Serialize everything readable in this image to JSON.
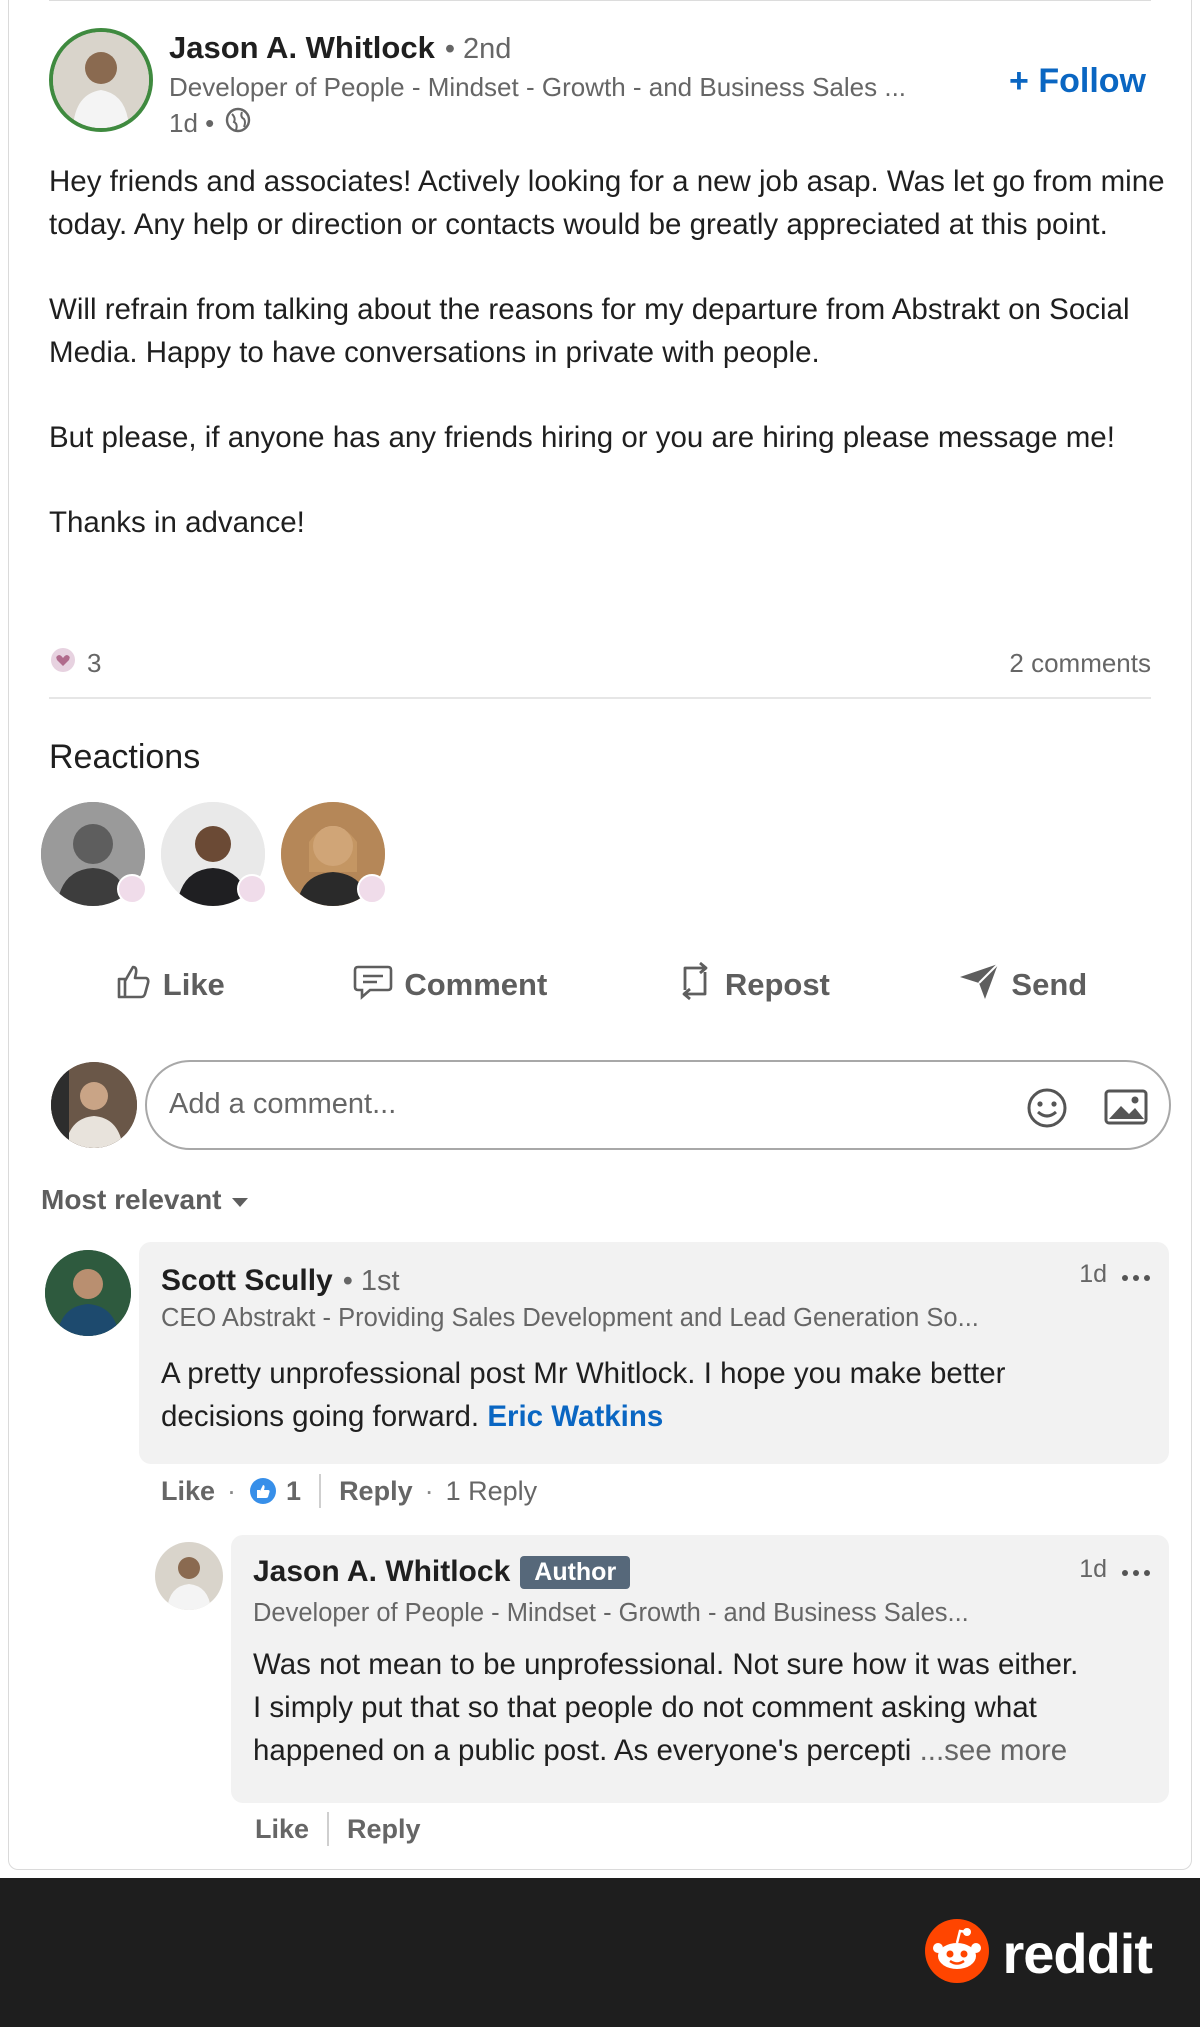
{
  "post": {
    "author_name": "Jason A. Whitlock",
    "degree": "• 2nd",
    "headline": "Developer of People - Mindset - Growth - and Business Sales ...",
    "time": "1d •",
    "follow_label": "+ Follow",
    "paragraphs": [
      "Hey friends and associates! Actively looking for a new job asap. Was let go from mine today. Any help or direction or contacts would be greatly appreciated at this point.",
      "Will refrain from talking about the reasons for my departure from Abstrakt on Social Media. Happy to have conversations in private with people.",
      "But please, if anyone has any friends hiring or you are hiring please message me!",
      "Thanks in advance!"
    ],
    "reaction_count": "3",
    "comment_count": "2 comments"
  },
  "reactions": {
    "title": "Reactions"
  },
  "actions": {
    "like": "Like",
    "comment": "Comment",
    "repost": "Repost",
    "send": "Send"
  },
  "comment_box": {
    "placeholder": "Add a comment..."
  },
  "sort": {
    "label": "Most relevant"
  },
  "comments": [
    {
      "name": "Scott Scully",
      "degree": "• 1st",
      "headline": "CEO Abstrakt - Providing Sales Development and Lead Generation So...",
      "time": "1d",
      "text": "A pretty unprofessional post Mr Whitlock. I hope you make better decisions going forward.",
      "mention": "Eric Watkins",
      "like_label": "Like",
      "like_count": "1",
      "reply_label": "Reply",
      "replies_label": "1 Reply"
    },
    {
      "name": "Jason A. Whitlock",
      "tag": "Author",
      "headline": "Developer of People - Mindset - Growth - and Business Sales...",
      "time": "1d",
      "text_line1": "Was not mean to be unprofessional. Not sure how it was either.",
      "text_line2": "I simply put that so that people do not comment asking what",
      "text_line3": "happened on a public post. As everyone's percepti",
      "see_more": "...see more",
      "like_label": "Like",
      "reply_label": "Reply"
    }
  ],
  "footer": {
    "brand": "reddit"
  },
  "colors": {
    "accent_blue": "#0a66c2",
    "author_tag": "#56687a",
    "footer_bg": "#1e1e1e",
    "reddit_orange": "#ff4500"
  }
}
